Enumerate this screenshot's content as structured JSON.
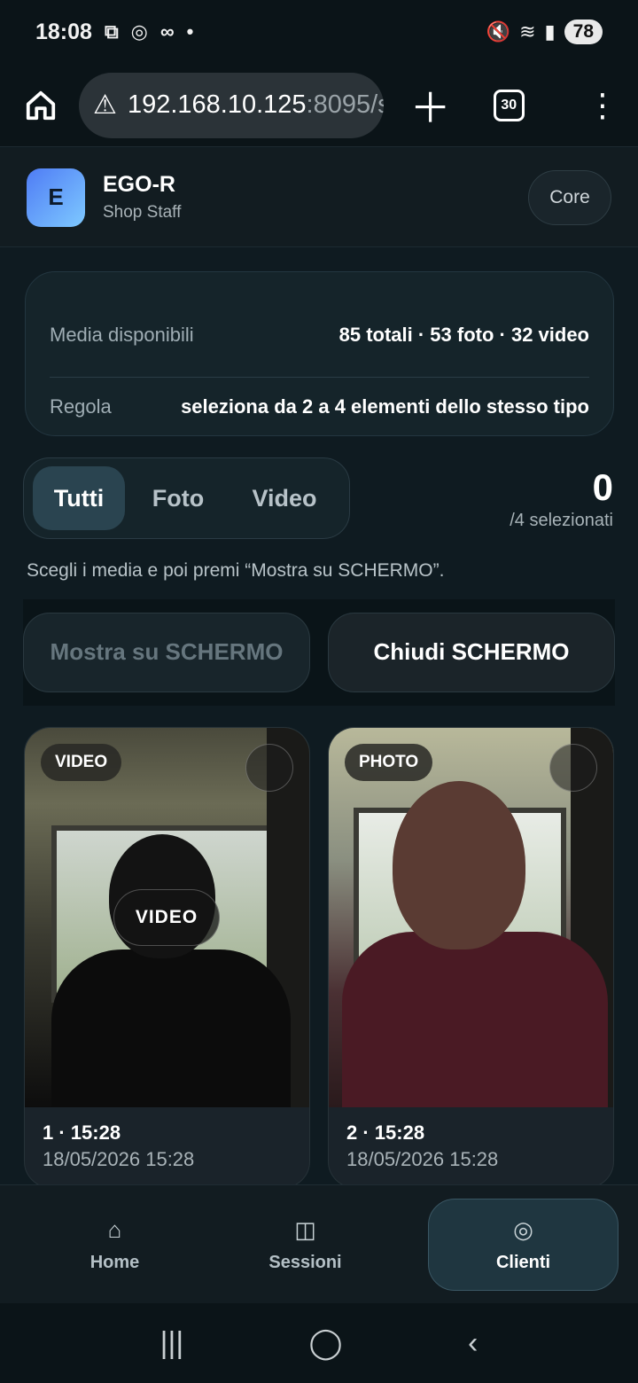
{
  "status_bar": {
    "time": "18:08",
    "battery": "78",
    "icons_left": [
      "screenshot-icon",
      "whatsapp-icon",
      "voicemail-icon",
      "dot-icon"
    ],
    "icons_right": [
      "mute-icon",
      "wifi-icon",
      "signal-icon"
    ]
  },
  "browser": {
    "url_host": "192.168.10.125",
    "url_port": ":8095/s",
    "tabs_count": "30"
  },
  "header": {
    "avatar_letter": "E",
    "brand_name": "EGO-R",
    "brand_role": "Shop Staff",
    "core_label": "Core"
  },
  "info": {
    "media_label": "Media disponibili",
    "media_value": "85 totali · 53 foto · 32 video",
    "rule_label": "Regola",
    "rule_value": "seleziona da 2 a 4 elementi dello stesso tipo"
  },
  "filter": {
    "tabs": [
      "Tutti",
      "Foto",
      "Video"
    ],
    "active": "Tutti"
  },
  "counter": {
    "value": "0",
    "label": "/4 selezionati"
  },
  "hint": "Scegli i media e poi premi “Mostra su SCHERMO”.",
  "actions": {
    "show_label": "Mostra su SCHERMO",
    "close_label": "Chiudi SCHERMO"
  },
  "media": [
    {
      "type": "VIDEO",
      "overlay": "VIDEO",
      "title": "1 · 15:28",
      "date": "18/05/2026 15:28"
    },
    {
      "type": "PHOTO",
      "title": "2 · 15:28",
      "date": "18/05/2026 15:28"
    }
  ],
  "bottom_nav": [
    {
      "label": "Home",
      "icon": "home-icon"
    },
    {
      "label": "Sessioni",
      "icon": "columns-icon"
    },
    {
      "label": "Clienti",
      "icon": "target-icon"
    }
  ]
}
